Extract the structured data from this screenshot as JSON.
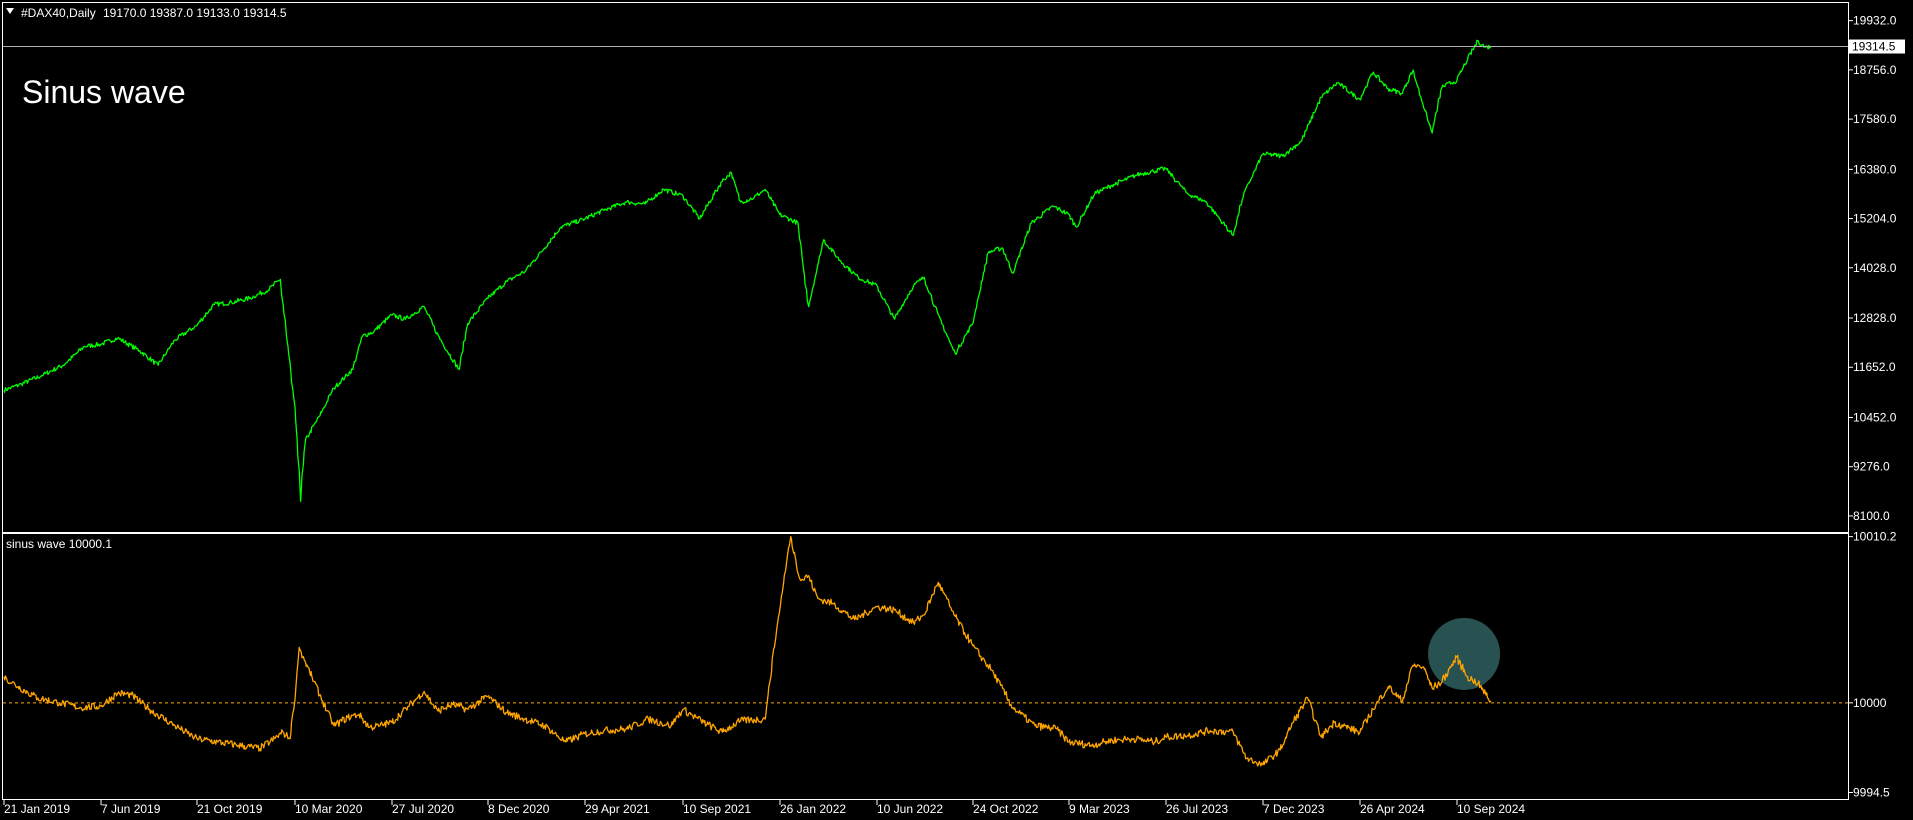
{
  "window": {
    "symbol_label": "#DAX40,Daily",
    "ohlc_label": "19170.0 19387.0 19133.0 19314.5",
    "annotation": "Sinus wave"
  },
  "colors": {
    "background": "#000000",
    "frame": "#ffffff",
    "price_line": "#00ff00",
    "indicator_line": "#ffa500",
    "level_line": "#ffa500",
    "current_price_line": "#b0b0b0",
    "highlight_circle": "#2f5f5f"
  },
  "chart_data": [
    {
      "type": "line",
      "name": "#DAX40,Daily",
      "last_price": 19314.5,
      "ylim": [
        7740,
        20330
      ],
      "yticks": [
        {
          "value": 19932.0,
          "label": "19932.0"
        },
        {
          "value": 18756.0,
          "label": "18756.0"
        },
        {
          "value": 17580.0,
          "label": "17580.0"
        },
        {
          "value": 16380.0,
          "label": "16380.0"
        },
        {
          "value": 15204.0,
          "label": "15204.0"
        },
        {
          "value": 14028.0,
          "label": "14028.0"
        },
        {
          "value": 12828.0,
          "label": "12828.0"
        },
        {
          "value": 11652.0,
          "label": "11652.0"
        },
        {
          "value": 10452.0,
          "label": "10452.0"
        },
        {
          "value": 9276.0,
          "label": "9276.0"
        },
        {
          "value": 8100.0,
          "label": "8100.0"
        }
      ],
      "series": [
        {
          "color": "#00ff00",
          "x": [
            "2019-01-21",
            "2019-02-15",
            "2019-03-15",
            "2019-04-15",
            "2019-05-15",
            "2019-06-07",
            "2019-07-01",
            "2019-08-01",
            "2019-08-27",
            "2019-09-20",
            "2019-10-21",
            "2019-11-15",
            "2019-12-10",
            "2020-01-05",
            "2020-02-01",
            "2020-02-18",
            "2020-03-10",
            "2020-03-16",
            "2020-03-18",
            "2020-03-25",
            "2020-04-15",
            "2020-05-05",
            "2020-06-01",
            "2020-06-15",
            "2020-07-01",
            "2020-07-27",
            "2020-08-15",
            "2020-09-10",
            "2020-09-30",
            "2020-10-29",
            "2020-11-10",
            "2020-12-08",
            "2021-01-05",
            "2021-02-01",
            "2021-03-01",
            "2021-03-25",
            "2021-04-29",
            "2021-05-25",
            "2021-06-25",
            "2021-07-20",
            "2021-08-15",
            "2021-09-10",
            "2021-10-04",
            "2021-11-05",
            "2021-11-18",
            "2021-12-01",
            "2021-12-20",
            "2022-01-05",
            "2022-01-26",
            "2022-02-20",
            "2022-03-07",
            "2022-03-28",
            "2022-04-20",
            "2022-05-15",
            "2022-06-10",
            "2022-07-05",
            "2022-08-01",
            "2022-08-16",
            "2022-09-05",
            "2022-09-29",
            "2022-10-24",
            "2022-11-15",
            "2022-12-05",
            "2022-12-20",
            "2023-01-15",
            "2023-02-15",
            "2023-03-09",
            "2023-03-20",
            "2023-04-15",
            "2023-05-10",
            "2023-06-15",
            "2023-07-26",
            "2023-08-25",
            "2023-09-20",
            "2023-10-27",
            "2023-11-10",
            "2023-12-07",
            "2024-01-05",
            "2024-02-01",
            "2024-03-01",
            "2024-03-25",
            "2024-04-26",
            "2024-05-15",
            "2024-06-05",
            "2024-06-25",
            "2024-07-10",
            "2024-08-06",
            "2024-08-20",
            "2024-09-10",
            "2024-09-25",
            "2024-10-10",
            "2024-10-20",
            "2024-10-28"
          ],
          "y": [
            11100,
            11250,
            11450,
            11700,
            12150,
            12200,
            12350,
            12050,
            11700,
            12300,
            12650,
            13150,
            13200,
            13300,
            13500,
            13750,
            10700,
            9200,
            8450,
            9900,
            10500,
            11150,
            11600,
            12400,
            12500,
            12900,
            12800,
            13100,
            12400,
            11600,
            12700,
            13300,
            13700,
            13950,
            14500,
            15000,
            15200,
            15400,
            15600,
            15550,
            15900,
            15750,
            15200,
            16100,
            16300,
            15600,
            15700,
            15900,
            15300,
            15100,
            13100,
            14700,
            14200,
            13800,
            13600,
            12800,
            13600,
            13800,
            12900,
            11975,
            12700,
            14400,
            14500,
            13900,
            15100,
            15500,
            15300,
            15000,
            15800,
            16000,
            16250,
            16400,
            15800,
            15600,
            14800,
            15750,
            16750,
            16700,
            17050,
            18100,
            18450,
            18050,
            18700,
            18300,
            18200,
            18750,
            17250,
            18350,
            18500,
            19000,
            19450,
            19300,
            19314.5
          ]
        }
      ]
    },
    {
      "type": "line",
      "name": "sinus wave",
      "value_label": "sinus wave 10000.1",
      "ylim": [
        9994.1,
        10010.3
      ],
      "level": 10000,
      "yticks": [
        {
          "value": 10010.2,
          "label": "10010.2"
        },
        {
          "value": 10000,
          "label": "10000"
        },
        {
          "value": 9994.5,
          "label": "9994.5"
        }
      ],
      "series": [
        {
          "color": "#ffa500",
          "x": [
            "2019-01-21",
            "2019-02-10",
            "2019-03-10",
            "2019-04-10",
            "2019-05-10",
            "2019-06-07",
            "2019-07-01",
            "2019-07-20",
            "2019-08-15",
            "2019-09-20",
            "2019-10-21",
            "2019-11-20",
            "2019-12-20",
            "2020-01-20",
            "2020-02-10",
            "2020-02-22",
            "2020-03-03",
            "2020-03-10",
            "2020-03-16",
            "2020-03-25",
            "2020-04-15",
            "2020-05-05",
            "2020-05-25",
            "2020-06-10",
            "2020-06-25",
            "2020-07-10",
            "2020-07-27",
            "2020-08-20",
            "2020-09-10",
            "2020-09-29",
            "2020-10-20",
            "2020-11-10",
            "2020-12-08",
            "2021-01-05",
            "2021-02-01",
            "2021-03-01",
            "2021-04-01",
            "2021-04-29",
            "2021-05-25",
            "2021-06-25",
            "2021-07-25",
            "2021-08-25",
            "2021-09-10",
            "2021-10-10",
            "2021-11-05",
            "2021-12-01",
            "2022-01-05",
            "2022-01-20",
            "2022-02-10",
            "2022-02-24",
            "2022-03-07",
            "2022-03-20",
            "2022-04-10",
            "2022-05-10",
            "2022-06-10",
            "2022-07-05",
            "2022-08-01",
            "2022-08-16",
            "2022-09-05",
            "2022-09-29",
            "2022-10-24",
            "2022-11-20",
            "2022-12-20",
            "2023-01-20",
            "2023-02-20",
            "2023-03-09",
            "2023-04-10",
            "2023-05-10",
            "2023-06-10",
            "2023-07-10",
            "2023-07-26",
            "2023-08-25",
            "2023-09-25",
            "2023-10-27",
            "2023-11-15",
            "2023-12-07",
            "2024-01-01",
            "2024-01-20",
            "2024-02-10",
            "2024-03-01",
            "2024-03-20",
            "2024-04-26",
            "2024-05-15",
            "2024-06-05",
            "2024-06-25",
            "2024-07-10",
            "2024-07-25",
            "2024-08-06",
            "2024-08-20",
            "2024-09-10",
            "2024-09-25",
            "2024-10-10",
            "2024-10-28"
          ],
          "y": [
            10001.6,
            10001.0,
            10000.3,
            10000.0,
            9999.7,
            9999.8,
            10000.6,
            10000.5,
            9999.6,
            9998.6,
            9997.8,
            9997.6,
            9997.4,
            9997.2,
            9997.8,
            9998.2,
            9997.8,
            10000.2,
            10003.4,
            10002.5,
            10000.5,
            9998.6,
            9999.1,
            9999.3,
            9998.5,
            9998.6,
            9998.8,
            9999.8,
            10000.7,
            9999.5,
            9999.9,
            9999.6,
            10000.4,
            9999.4,
            9999.0,
            9998.6,
            9997.6,
            9998.1,
            9998.3,
            9998.4,
            9999.0,
            9998.6,
            9999.6,
            9998.8,
            9998.2,
            9998.9,
            9999.0,
            10004.0,
            10010.2,
            10007.5,
            10007.8,
            10006.4,
            10006.1,
            10005.1,
            10005.9,
            10005.7,
            10004.9,
            10005.4,
            10007.4,
            10005.3,
            10003.5,
            10002.0,
            9999.7,
            9998.6,
            9998.4,
            9997.6,
            9997.4,
            9997.7,
            9997.8,
            9997.6,
            9997.9,
            9998.0,
            9998.3,
            9998.2,
            9996.6,
            9996.2,
            9997.1,
            9998.8,
            10000.3,
            9997.9,
            9998.8,
            9998.2,
            9999.6,
            10001.0,
            10000.1,
            10002.3,
            10002.2,
            10000.9,
            10001.3,
            10002.8,
            10001.6,
            10001.2,
            10000.1
          ]
        }
      ]
    }
  ],
  "x_axis": {
    "labels": [
      {
        "date": "2019-01-21",
        "text": "21 Jan 2019"
      },
      {
        "date": "2019-06-07",
        "text": "7 Jun 2019"
      },
      {
        "date": "2019-10-21",
        "text": "21 Oct 2019"
      },
      {
        "date": "2020-03-10",
        "text": "10 Mar 2020"
      },
      {
        "date": "2020-07-27",
        "text": "27 Jul 2020"
      },
      {
        "date": "2020-12-08",
        "text": "8 Dec 2020"
      },
      {
        "date": "2021-04-29",
        "text": "29 Apr 2021"
      },
      {
        "date": "2021-09-10",
        "text": "10 Sep 2021"
      },
      {
        "date": "2022-01-26",
        "text": "26 Jan 2022"
      },
      {
        "date": "2022-06-10",
        "text": "10 Jun 2022"
      },
      {
        "date": "2022-10-24",
        "text": "24 Oct 2022"
      },
      {
        "date": "2023-03-09",
        "text": "9 Mar 2023"
      },
      {
        "date": "2023-07-26",
        "text": "26 Jul 2023"
      },
      {
        "date": "2023-12-07",
        "text": "7 Dec 2023"
      },
      {
        "date": "2024-04-26",
        "text": "26 Apr 2024"
      },
      {
        "date": "2024-09-10",
        "text": "10 Sep 2024"
      }
    ]
  },
  "highlight": {
    "date": "2024-09-20",
    "value": 10003.0
  }
}
